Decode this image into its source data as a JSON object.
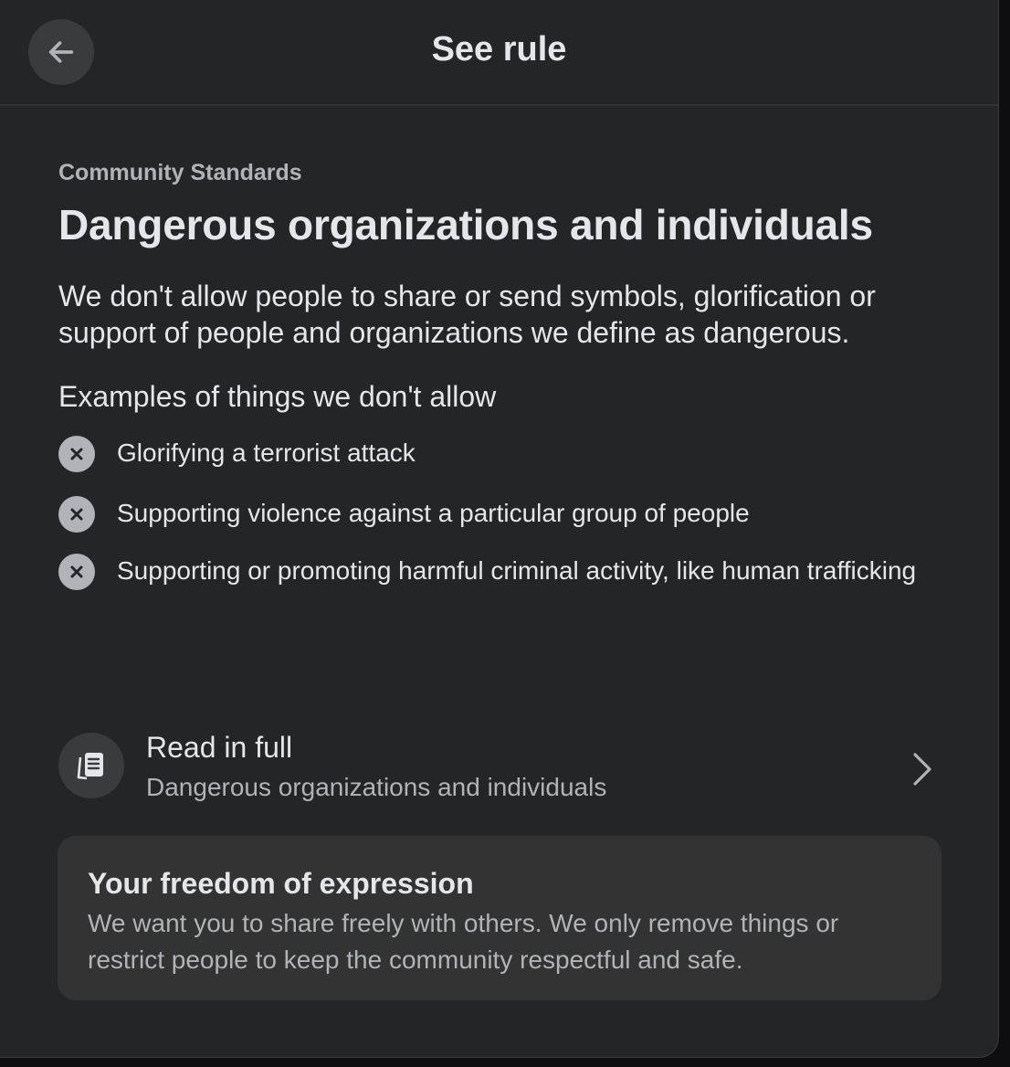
{
  "header": {
    "title": "See rule",
    "back_icon": "arrow-left-icon"
  },
  "rule": {
    "eyebrow": "Community Standards",
    "title": "Dangerous organizations and individuals",
    "description": "We don't allow people to share or send symbols, glorification or support of people and organizations we define as dangerous.",
    "examples_heading": "Examples of things we don't allow",
    "examples": [
      {
        "icon": "x-circle-icon",
        "text": "Glorifying a terrorist attack"
      },
      {
        "icon": "x-circle-icon",
        "text": "Supporting violence against a particular group of people"
      },
      {
        "icon": "x-circle-icon",
        "text": "Supporting or promoting harmful criminal activity, like human trafficking"
      }
    ]
  },
  "read_full": {
    "icon": "document-icon",
    "title": "Read in full",
    "subtitle": "Dangerous organizations and individuals",
    "chevron_icon": "chevron-right-icon"
  },
  "freedom": {
    "title": "Your freedom of expression",
    "text": "We want you to share freely with others. We only remove things or restrict people to keep the community respectful and safe."
  },
  "colors": {
    "background": "#242527",
    "text_primary": "#e4e6eb",
    "text_secondary": "#b0b3b8",
    "card": "#333334",
    "button": "#3a3b3c"
  }
}
